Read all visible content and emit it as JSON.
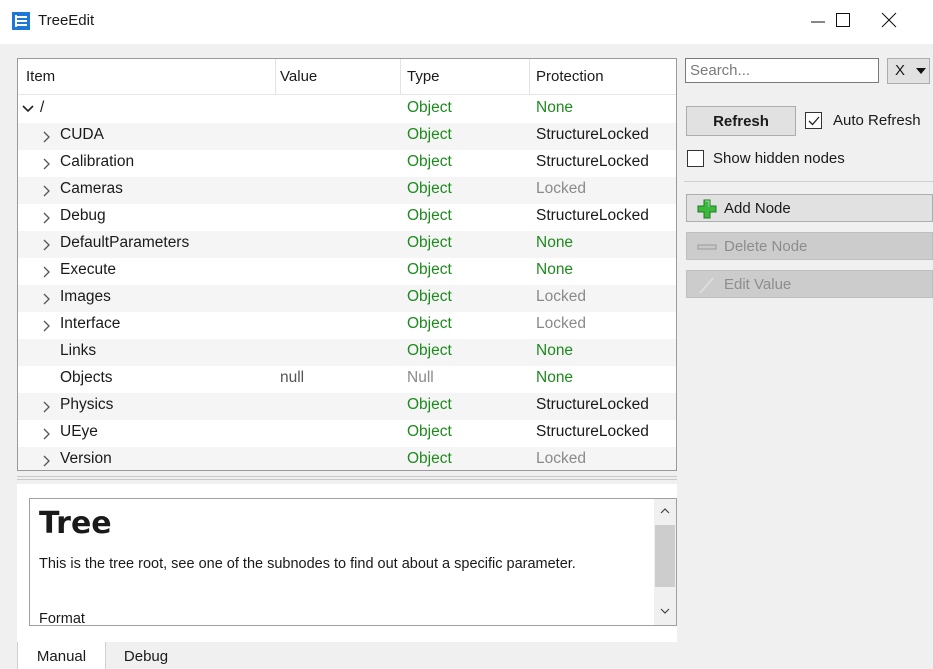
{
  "window": {
    "title": "TreeEdit",
    "icon": "tree-edit-icon"
  },
  "tree": {
    "headers": [
      "Item",
      "Value",
      "Type",
      "Protection"
    ],
    "rows": [
      {
        "item": "/",
        "value": "",
        "type": "Object",
        "protection": "None",
        "expander": "expanded"
      },
      {
        "item": "CUDA",
        "value": "",
        "type": "Object",
        "protection": "StructureLocked",
        "expander": "collapsed"
      },
      {
        "item": "Calibration",
        "value": "",
        "type": "Object",
        "protection": "StructureLocked",
        "expander": "collapsed"
      },
      {
        "item": "Cameras",
        "value": "",
        "type": "Object",
        "protection": "Locked",
        "expander": "collapsed"
      },
      {
        "item": "Debug",
        "value": "",
        "type": "Object",
        "protection": "StructureLocked",
        "expander": "collapsed"
      },
      {
        "item": "DefaultParameters",
        "value": "",
        "type": "Object",
        "protection": "None",
        "expander": "collapsed"
      },
      {
        "item": "Execute",
        "value": "",
        "type": "Object",
        "protection": "None",
        "expander": "collapsed"
      },
      {
        "item": "Images",
        "value": "",
        "type": "Object",
        "protection": "Locked",
        "expander": "collapsed"
      },
      {
        "item": "Interface",
        "value": "",
        "type": "Object",
        "protection": "Locked",
        "expander": "collapsed"
      },
      {
        "item": "Links",
        "value": "",
        "type": "Object",
        "protection": "None",
        "expander": "none"
      },
      {
        "item": "Objects",
        "value": "null",
        "type": "Null",
        "protection": "None",
        "expander": "none"
      },
      {
        "item": "Physics",
        "value": "",
        "type": "Object",
        "protection": "StructureLocked",
        "expander": "collapsed"
      },
      {
        "item": "UEye",
        "value": "",
        "type": "Object",
        "protection": "StructureLocked",
        "expander": "collapsed"
      },
      {
        "item": "Version",
        "value": "",
        "type": "Object",
        "protection": "Locked",
        "expander": "collapsed"
      }
    ]
  },
  "doc": {
    "title": "Tree",
    "body": "This is the tree root, see one of the subnodes to find out about a specific parameter.",
    "format_heading": "Format"
  },
  "tabs": [
    "Manual",
    "Debug"
  ],
  "search": {
    "placeholder": "Search...",
    "value": "",
    "clear_label": "X"
  },
  "refresh_label": "Refresh",
  "auto_refresh": {
    "label": "Auto Refresh",
    "checked": true
  },
  "show_hidden": {
    "label": "Show hidden nodes",
    "checked": false
  },
  "actions": {
    "add": {
      "label": "Add Node",
      "icon": "plus-icon"
    },
    "delete": {
      "label": "Delete Node",
      "icon": "minus-icon"
    },
    "edit": {
      "label": "Edit Value",
      "icon": "pencil-icon"
    }
  },
  "colors": {
    "type_object": "#1e8a1e",
    "protection_none": "#1e8a1e",
    "muted": "#8a8a8a"
  }
}
